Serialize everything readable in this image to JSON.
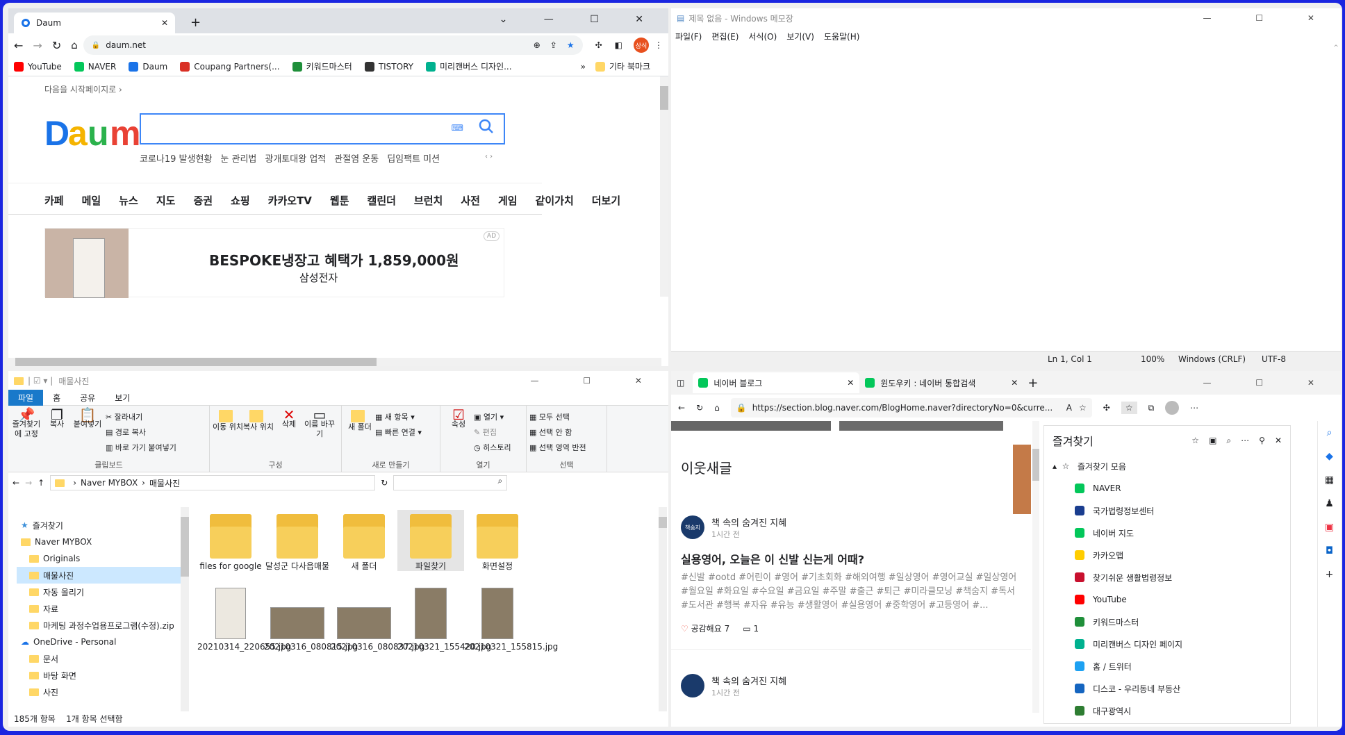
{
  "chrome": {
    "tab_title": "Daum",
    "url": "daum.net",
    "avatar": "상식",
    "bookmarks": [
      {
        "label": "YouTube",
        "color": "#ff0000"
      },
      {
        "label": "NAVER",
        "color": "#03c75a"
      },
      {
        "label": "Daum",
        "color": "#1a73e8"
      },
      {
        "label": "Coupang Partners(...",
        "color": "#d93025"
      },
      {
        "label": "키워드마스터",
        "color": "#1f8f3a"
      },
      {
        "label": "TISTORY",
        "color": "#333333"
      },
      {
        "label": "미리캔버스 디자인...",
        "color": "#00b18f"
      }
    ],
    "other_bookmarks": "기타 북마크",
    "page": {
      "set_home": "다음을 시작페이지로 ›",
      "trends": [
        "코로나19 발생현황",
        "눈 관리법",
        "광개토대왕 업적",
        "관절염 운동",
        "딥임팩트 미션"
      ],
      "menu": [
        "카페",
        "메일",
        "뉴스",
        "지도",
        "증권",
        "쇼핑",
        "카카오TV",
        "웹툰",
        "캘린더",
        "브런치",
        "사전",
        "게임",
        "같이가치",
        "더보기"
      ],
      "ad_badge": "AD",
      "ad_title": "BESPOKE냉장고 혜택가 1,859,000원",
      "ad_sub": "삼성전자"
    }
  },
  "notepad": {
    "title": "제목 없음 - Windows 메모장",
    "menus": [
      "파일(F)",
      "편집(E)",
      "서식(O)",
      "보기(V)",
      "도움말(H)"
    ],
    "status": {
      "pos": "Ln 1, Col 1",
      "zoom": "100%",
      "eol": "Windows (CRLF)",
      "enc": "UTF-8"
    }
  },
  "explorer": {
    "title": "매물사진",
    "tabs": [
      "파일",
      "홈",
      "공유",
      "보기"
    ],
    "ribbon": {
      "g1": [
        "즐겨찾기에 고정",
        "복사",
        "붙여넣기"
      ],
      "g1_small": [
        "잘라내기",
        "경로 복사",
        "바로 가기 붙여넣기"
      ],
      "g1_label": "클립보드",
      "g2": [
        "이동 위치",
        "복사 위치",
        "삭제",
        "이름 바꾸기"
      ],
      "g2_label": "구성",
      "g3": [
        "새 폴더"
      ],
      "g3_small": [
        "새 항목",
        "빠른 연결"
      ],
      "g3_label": "새로 만들기",
      "g4": [
        "속성"
      ],
      "g4_small": [
        "열기",
        "편집",
        "히스토리"
      ],
      "g4_label": "열기",
      "g5_small": [
        "모두 선택",
        "선택 안 함",
        "선택 영역 반전"
      ],
      "g5_label": "선택"
    },
    "path": [
      "Naver MYBOX",
      "매물사진"
    ],
    "tree": [
      "즐겨찾기",
      "Naver MYBOX",
      "Originals",
      "매물사진",
      "자동 올리기",
      "자료",
      "마케팅 과정수업용프로그램(수정).zip",
      "OneDrive - Personal",
      "문서",
      "바탕 화면",
      "사진"
    ],
    "items": [
      "files for google",
      "달성군 다사읍매물",
      "새 폴더",
      "파일찾기",
      "화면설정",
      "20210314_220655.jpg",
      "20210316_080815.jpg",
      "20210316_080837.jpg",
      "20210321_155420.jpg",
      "20210321_155815.jpg"
    ],
    "status": "185개 항목    1개 항목 선택함"
  },
  "edge": {
    "tabs": [
      "네이버 블로그",
      "윈도우키 : 네이버 통합검색"
    ],
    "url": "https://section.blog.naver.com/BlogHome.naver?directoryNo=0&curre...",
    "section": "이웃새글",
    "post": {
      "author": "책 속의 숨겨진 지혜",
      "time": "1시간 전",
      "title": "실용영어, 오늘은 이 신발 신는게 어때?",
      "tags": "#신발 #ootd #어린이 #영어 #기초회화 #해외여행 #일상영어 #영어교실 #일상영어 #월요일 #화요일 #수요일 #금요일 #주말 #출근 #퇴근 #미라클모닝 #책숨지 #독서 #도서관 #행복 #자유 #유능 #생활영어 #실용영어 #중학영어 #고등영어 #...",
      "likes": "공감해요 7",
      "comments": "1"
    },
    "post2": {
      "author": "책 속의 숨겨진 지혜",
      "time": "1시간 전"
    },
    "fav": {
      "title": "즐겨찾기",
      "folder": "즐겨찾기 모음",
      "items": [
        {
          "label": "NAVER",
          "color": "#03c75a"
        },
        {
          "label": "국가법령정보센터",
          "color": "#1a3d8f"
        },
        {
          "label": "네이버 지도",
          "color": "#03c75a"
        },
        {
          "label": "카카오맵",
          "color": "#ffcd00"
        },
        {
          "label": "찾기쉬운 생활법령정보",
          "color": "#c8102e"
        },
        {
          "label": "YouTube",
          "color": "#ff0000"
        },
        {
          "label": "키워드마스터",
          "color": "#1f8f3a"
        },
        {
          "label": "미리캔버스 디자인 페이지",
          "color": "#00b18f"
        },
        {
          "label": "홈 / 트위터",
          "color": "#1da1f2"
        },
        {
          "label": "디스코 - 우리동네 부동산",
          "color": "#1565c0"
        },
        {
          "label": "대구광역시",
          "color": "#2e7d32"
        }
      ]
    }
  }
}
